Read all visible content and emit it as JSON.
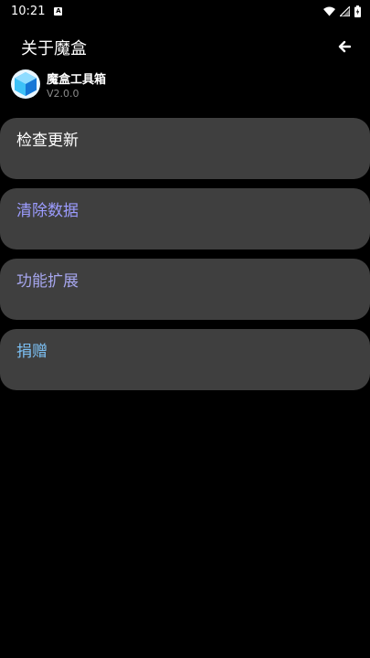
{
  "status_bar": {
    "time": "10:21",
    "notification_glyph": "A",
    "icons": [
      "wifi-icon",
      "signal-icon",
      "battery-icon"
    ]
  },
  "app_bar": {
    "title": "关于魔盒",
    "back_icon": "arrow-left-icon"
  },
  "app_info": {
    "name": "魔盒工具箱",
    "version": "V2.0.0",
    "logo_icon": "cube-icon"
  },
  "menu": {
    "items": [
      {
        "label": "检查更新",
        "color": "#ffffff"
      },
      {
        "label": "清除数据",
        "color": "#9c9cff"
      },
      {
        "label": "功能扩展",
        "color": "#a6a6ee"
      },
      {
        "label": "捐赠",
        "color": "#7cc0f4"
      }
    ]
  },
  "colors": {
    "background": "#000000",
    "card": "#3f3f3f",
    "version_text": "#8a8a8a"
  }
}
